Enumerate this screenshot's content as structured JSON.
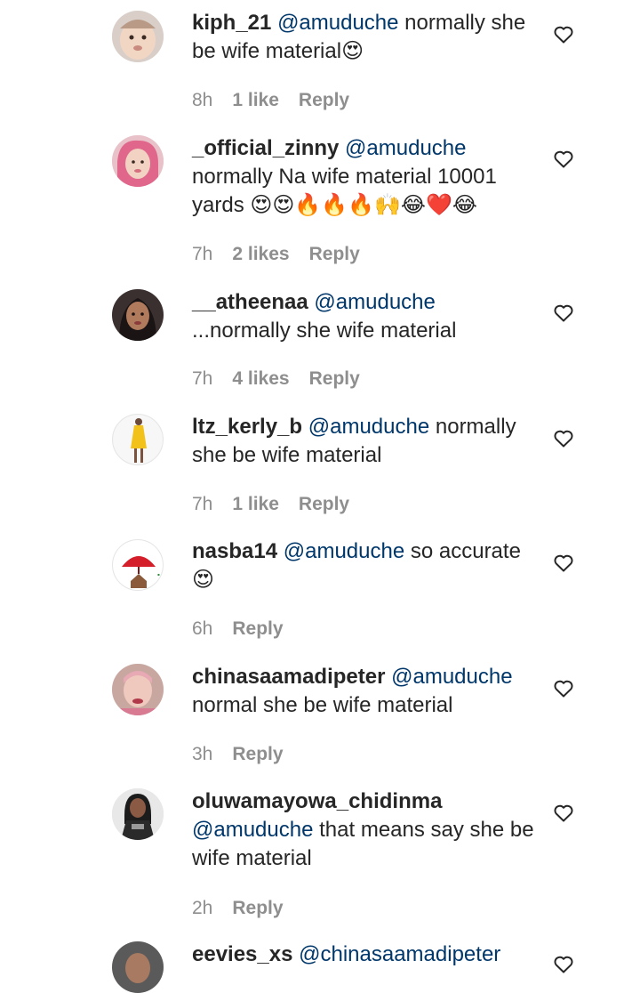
{
  "comments": [
    {
      "username": "kiph_21",
      "mention": "@amuduche",
      "text": " normally she be wife material😍",
      "time": "8h",
      "likes": "1 like",
      "reply": "Reply",
      "avatar_icon": "baby-face-photo-icon"
    },
    {
      "username": "_official_zinny",
      "mention": "@amuduche",
      "text": " normally Na wife material 10001 yards 😍😍🔥🔥🔥🙌😂❤️😂",
      "time": "7h",
      "likes": "2 likes",
      "reply": "Reply",
      "avatar_icon": "pink-hair-photo-icon"
    },
    {
      "username": "__atheenaa",
      "mention": "@amuduche",
      "text": " ...normally she wife material",
      "time": "7h",
      "likes": "4 likes",
      "reply": "Reply",
      "avatar_icon": "woman-portrait-photo-icon"
    },
    {
      "username": "ltz_kerly_b",
      "mention": "@amuduche",
      "text": " normally she be wife material",
      "time": "7h",
      "likes": "1 like",
      "reply": "Reply",
      "avatar_icon": "yellow-dress-photo-icon"
    },
    {
      "username": "nasba14",
      "mention": "@amuduche",
      "text": " so accurate😍",
      "time": "6h",
      "likes": "",
      "reply": "Reply",
      "avatar_icon": "red-umbrella-house-logo-icon"
    },
    {
      "username": "chinasaamadipeter",
      "mention": "@amuduche",
      "text": " normal she be wife material",
      "time": "3h",
      "likes": "",
      "reply": "Reply",
      "avatar_icon": "selfie-photo-icon"
    },
    {
      "username": "oluwamayowa_chidinma",
      "mention": "@amuduche",
      "text": " that means say she be wife material",
      "time": "2h",
      "likes": "",
      "reply": "Reply",
      "avatar_icon": "woman-dark-outfit-photo-icon"
    },
    {
      "username": "eevies_xs",
      "mention": "@chinasaamadipeter",
      "text": "",
      "time": "",
      "likes": "",
      "reply": "",
      "avatar_icon": "profile-photo-icon"
    }
  ]
}
